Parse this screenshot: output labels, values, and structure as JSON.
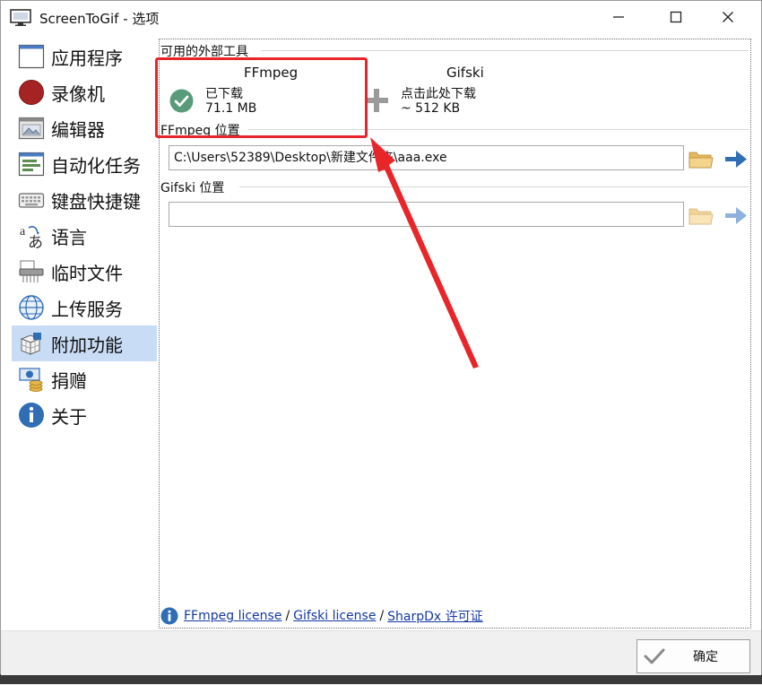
{
  "window": {
    "title": "ScreenToGif - 选项",
    "controls": {
      "minimize": "—",
      "maximize": "☐",
      "close": "✕"
    }
  },
  "sidebar": {
    "items": [
      {
        "label": "应用程序",
        "icon": "application-window-icon",
        "active": false
      },
      {
        "label": "录像机",
        "icon": "record-icon",
        "active": false
      },
      {
        "label": "编辑器",
        "icon": "editor-icon",
        "active": false
      },
      {
        "label": "自动化任务",
        "icon": "automation-icon",
        "active": false
      },
      {
        "label": "键盘快捷键",
        "icon": "keyboard-icon",
        "active": false
      },
      {
        "label": "语言",
        "icon": "language-icon",
        "active": false
      },
      {
        "label": "临时文件",
        "icon": "temp-files-icon",
        "active": false
      },
      {
        "label": "上传服务",
        "icon": "globe-icon",
        "active": false
      },
      {
        "label": "附加功能",
        "icon": "extras-icon",
        "active": true
      },
      {
        "label": "捐赠",
        "icon": "donate-icon",
        "active": false
      },
      {
        "label": "关于",
        "icon": "info-icon",
        "active": false
      }
    ]
  },
  "external_tools": {
    "group_label": "可用的外部工具",
    "ffmpeg": {
      "name": "FFmpeg",
      "status": "已下载",
      "size": "71.1 MB"
    },
    "gifski": {
      "name": "Gifski",
      "status": "点击此处下载",
      "size": "~ 512 KB"
    }
  },
  "ffmpeg_location": {
    "label": "FFmpeg 位置",
    "value": "C:\\Users\\52389\\Desktop\\新建文件夹\\aaa.exe"
  },
  "gifski_location": {
    "label": "Gifski 位置",
    "value": ""
  },
  "licenses": {
    "ffmpeg": "FFmpeg license",
    "gifski": "Gifski license",
    "sharpdx": "SharpDx 许可证",
    "separator": "/"
  },
  "footer": {
    "ok_label": "确定"
  },
  "colors": {
    "accent": "#2f6db5",
    "active_bg": "#c9dcf5",
    "annotation_red": "#e8262a",
    "check_green": "#5a9b7c"
  }
}
